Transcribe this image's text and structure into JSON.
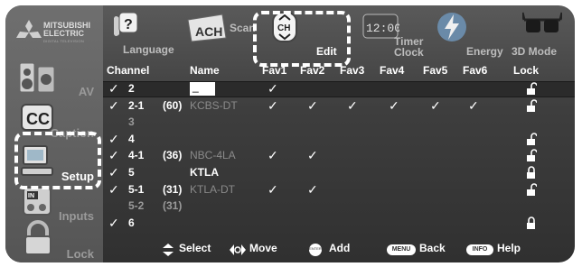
{
  "brand": {
    "line1": "MITSUBISHI",
    "line2": "ELECTRIC",
    "tagline": "DIGITAL TELEVISION"
  },
  "sidebar": {
    "items": [
      {
        "label": "AV",
        "icon": "speaker-icon",
        "active": false
      },
      {
        "label": "Caption",
        "icon": "cc-icon",
        "active": false
      },
      {
        "label": "Setup",
        "icon": "computer-icon",
        "active": true
      },
      {
        "label": "Inputs",
        "icon": "inputs-icon",
        "active": false
      },
      {
        "label": "Lock",
        "icon": "padlock-icon",
        "active": false
      }
    ]
  },
  "tabs": [
    {
      "label": "Language",
      "icon": "language-icon",
      "active": false
    },
    {
      "label": "Scan",
      "icon": "scan-icon",
      "active": false
    },
    {
      "label": "Edit",
      "icon": "ch-edit-icon",
      "active": true
    },
    {
      "label": "Timer Clock",
      "icon": "timer-clock-icon",
      "active": false
    },
    {
      "label": "Energy",
      "icon": "energy-icon",
      "active": false
    },
    {
      "label": "3D Mode",
      "icon": "3d-glasses-icon",
      "active": false
    }
  ],
  "table": {
    "headers": {
      "channel": "Channel",
      "name": "Name",
      "fav1": "Fav1",
      "fav2": "Fav2",
      "fav3": "Fav3",
      "fav4": "Fav4",
      "fav5": "Fav5",
      "fav6": "Fav6",
      "lock": "Lock"
    },
    "check_glyph": "✓",
    "rows": [
      {
        "check": "✓",
        "channel": "2",
        "code": "",
        "name": "_",
        "fav": [
          true,
          false,
          false,
          false,
          false,
          false
        ],
        "lock": "unlocked",
        "selected": true,
        "dim": false
      },
      {
        "check": "✓",
        "channel": "2-1",
        "code": "(60)",
        "name": "KCBS-DT",
        "fav": [
          true,
          true,
          true,
          true,
          true,
          true
        ],
        "lock": "unlocked",
        "selected": false,
        "dim": false
      },
      {
        "check": "",
        "channel": "3",
        "code": "",
        "name": "",
        "fav": [
          false,
          false,
          false,
          false,
          false,
          false
        ],
        "lock": "",
        "selected": false,
        "dim": true
      },
      {
        "check": "✓",
        "channel": "4",
        "code": "",
        "name": "",
        "fav": [
          false,
          false,
          false,
          false,
          false,
          false
        ],
        "lock": "unlocked",
        "selected": false,
        "dim": false
      },
      {
        "check": "✓",
        "channel": "4-1",
        "code": "(36)",
        "name": "NBC-4LA",
        "fav": [
          true,
          true,
          false,
          false,
          false,
          false
        ],
        "lock": "unlocked",
        "selected": false,
        "dim": false
      },
      {
        "check": "✓",
        "channel": "5",
        "code": "",
        "name": "KTLA",
        "fav": [
          false,
          false,
          false,
          false,
          false,
          false
        ],
        "lock": "locked",
        "selected": false,
        "dim": false
      },
      {
        "check": "✓",
        "channel": "5-1",
        "code": "(31)",
        "name": "KTLA-DT",
        "fav": [
          true,
          true,
          false,
          false,
          false,
          false
        ],
        "lock": "unlocked",
        "selected": false,
        "dim": false
      },
      {
        "check": "",
        "channel": "5-2",
        "code": "(31)",
        "name": "",
        "fav": [
          false,
          false,
          false,
          false,
          false,
          false
        ],
        "lock": "",
        "selected": false,
        "dim": true
      },
      {
        "check": "✓",
        "channel": "6",
        "code": "",
        "name": "",
        "fav": [
          false,
          false,
          false,
          false,
          false,
          false
        ],
        "lock": "locked",
        "selected": false,
        "dim": false
      }
    ]
  },
  "footer": {
    "select": "Select",
    "move": "Move",
    "add": "Add",
    "back": "Back",
    "help": "Help",
    "menu_key": "MENU",
    "info_key": "INFO",
    "enter_key": "ENTER"
  },
  "colors": {
    "panel": "#3e3e3e",
    "selected_row": "#2b2b2b",
    "highlight": "#ffffff"
  }
}
